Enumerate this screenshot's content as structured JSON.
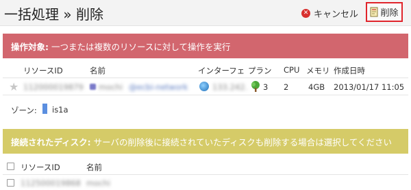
{
  "header": {
    "title": "一括処理 » 削除",
    "cancel_label": "キャンセル",
    "delete_label": "削除"
  },
  "target_banner": {
    "title": "操作対象:",
    "text": "一つまたは複数のリソースに対して操作を実行"
  },
  "resources_table": {
    "columns": [
      "リソースID",
      "名前",
      "インターフェ",
      "プラン",
      "CPU",
      "メモリ",
      "作成日時"
    ],
    "rows": [
      {
        "resource_id": "112000019879",
        "name": "mochi",
        "name_detail": "@ecbi-network",
        "interface": "133.242.",
        "plan": "3",
        "cpu": "2",
        "memory": "4GB",
        "created": "2013/01/17 11:05"
      }
    ]
  },
  "zone": {
    "label": "ゾーン:",
    "value": "is1a",
    "color": "#5b8fe0"
  },
  "disk_banner": {
    "title": "接続されたディスク:",
    "text": "サーバの削除後に接続されていたディスクも削除する場合は選択してください"
  },
  "disk_table": {
    "columns": [
      "リソースID",
      "名前"
    ],
    "rows": [
      {
        "resource_id": "112500019868",
        "name": "mochi"
      }
    ]
  },
  "colors": {
    "target_banner": "#d2666e",
    "disk_banner": "#d5cb68",
    "delete_border": "#e0242b"
  }
}
